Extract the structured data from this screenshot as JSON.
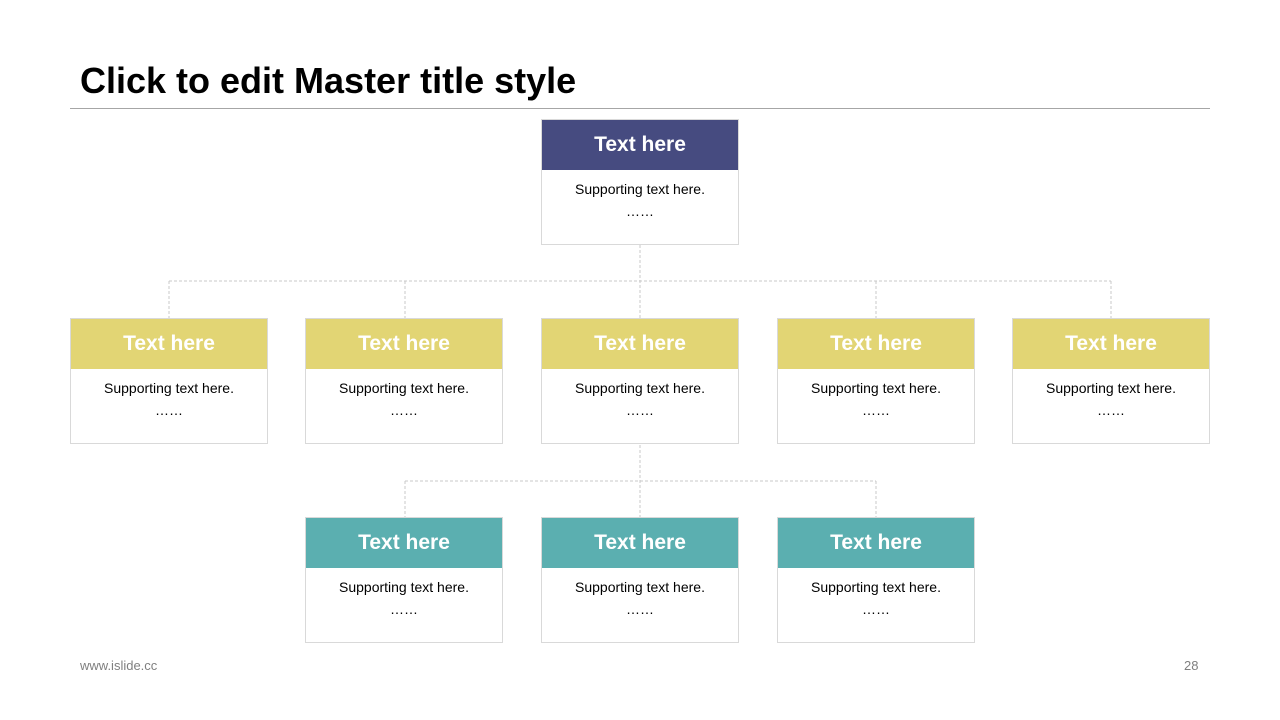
{
  "slide": {
    "title": "Click to edit Master title style",
    "footer_url": "www.islide.cc",
    "page_number": "28"
  },
  "colors": {
    "top": "#464b80",
    "middle": "#e2d574",
    "bottom": "#5bafb0",
    "connector": "#c8c8c8",
    "box_border": "#d9d9d9"
  },
  "org_chart": {
    "root": {
      "title": "Text here",
      "supporting": "Supporting text here.",
      "ellipsis": "……"
    },
    "level1": [
      {
        "title": "Text here",
        "supporting": "Supporting text here.",
        "ellipsis": "……"
      },
      {
        "title": "Text here",
        "supporting": "Supporting text here.",
        "ellipsis": "……"
      },
      {
        "title": "Text here",
        "supporting": "Supporting text here.",
        "ellipsis": "……"
      },
      {
        "title": "Text here",
        "supporting": "Supporting text here.",
        "ellipsis": "……"
      },
      {
        "title": "Text here",
        "supporting": "Supporting text here.",
        "ellipsis": "……"
      }
    ],
    "level2": [
      {
        "title": "Text here",
        "supporting": "Supporting text here.",
        "ellipsis": "……"
      },
      {
        "title": "Text here",
        "supporting": "Supporting text here.",
        "ellipsis": "……"
      },
      {
        "title": "Text here",
        "supporting": "Supporting text here.",
        "ellipsis": "……"
      }
    ]
  }
}
